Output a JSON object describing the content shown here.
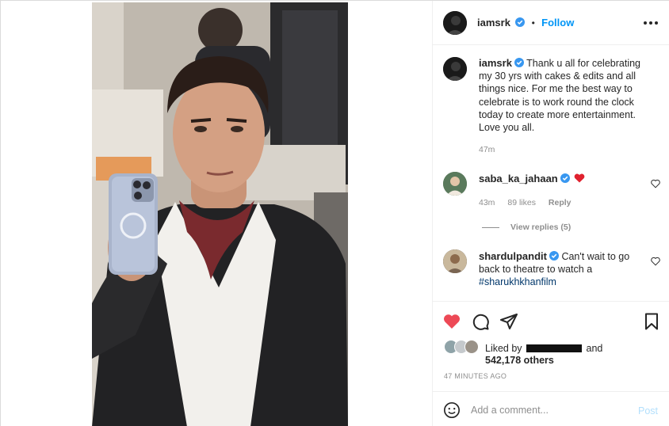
{
  "post": {
    "author": "iamsrk",
    "follow_label": "Follow",
    "separator": "•"
  },
  "caption": {
    "author": "iamsrk",
    "text": "Thank u all for celebrating my 30 yrs with cakes & edits and all things nice. For me the best way to celebrate is to work round the clock today to create more entertainment. Love you all.",
    "age": "47m"
  },
  "comments": [
    {
      "author": "saba_ka_jahaan",
      "text": "",
      "emoji": "red-heart",
      "age": "43m",
      "likes": "89 likes",
      "reply_label": "Reply",
      "view_replies": "View replies (5)"
    },
    {
      "author": "shardulpandit",
      "text": "Can't wait to go back to theatre to watch a ",
      "hashtag": "#sharukhkhanfilm"
    }
  ],
  "likes": {
    "prefix": "Liked by",
    "suffix": "and",
    "count_line": "542,178 others"
  },
  "timestamp": "47 MINUTES AGO",
  "composer": {
    "placeholder": "Add a comment...",
    "post_label": "Post"
  },
  "colors": {
    "accent": "#0095f6",
    "like_red": "#ed4956",
    "verified": "#3897f0"
  },
  "icons": [
    "verified-badge-icon",
    "more-options-icon",
    "heart-icon",
    "comment-icon",
    "share-icon",
    "save-icon",
    "emoji-icon"
  ]
}
